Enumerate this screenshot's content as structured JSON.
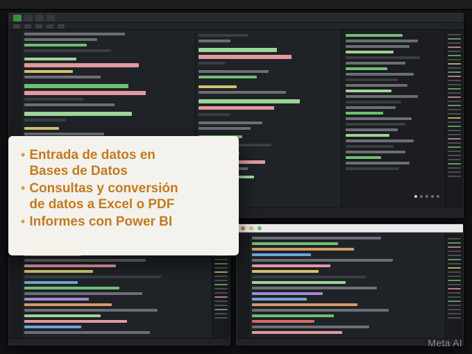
{
  "menubar": {
    "title": "",
    "right_status": "",
    "right_clock": ""
  },
  "topEditor": {
    "tabs": [
      {
        "label": "",
        "active": true
      },
      {
        "label": "",
        "active": false
      },
      {
        "label": "",
        "active": false
      },
      {
        "label": "",
        "active": false
      }
    ],
    "status": {
      "branch": "",
      "pages_label": ""
    }
  },
  "bottomLeft": {
    "title": ""
  },
  "bottomRight": {
    "title": ""
  },
  "overlay": {
    "bullets": [
      {
        "line1": "Entrada de datos en",
        "line2": "Bases de Datos"
      },
      {
        "line1": "Consultas y conversión",
        "line2": "de datos a Excel o PDF"
      },
      {
        "line1": "Informes con Power BI",
        "line2": ""
      }
    ]
  },
  "watermark": "Meta AI",
  "colors": {
    "accent_green": "#6fbf73",
    "accent_pink": "#e29aa0",
    "accent_yellow": "#d4c26a",
    "overlay_text": "#c47a1f",
    "overlay_bullet": "#d39a3f",
    "bg_editor": "#1f2226"
  }
}
